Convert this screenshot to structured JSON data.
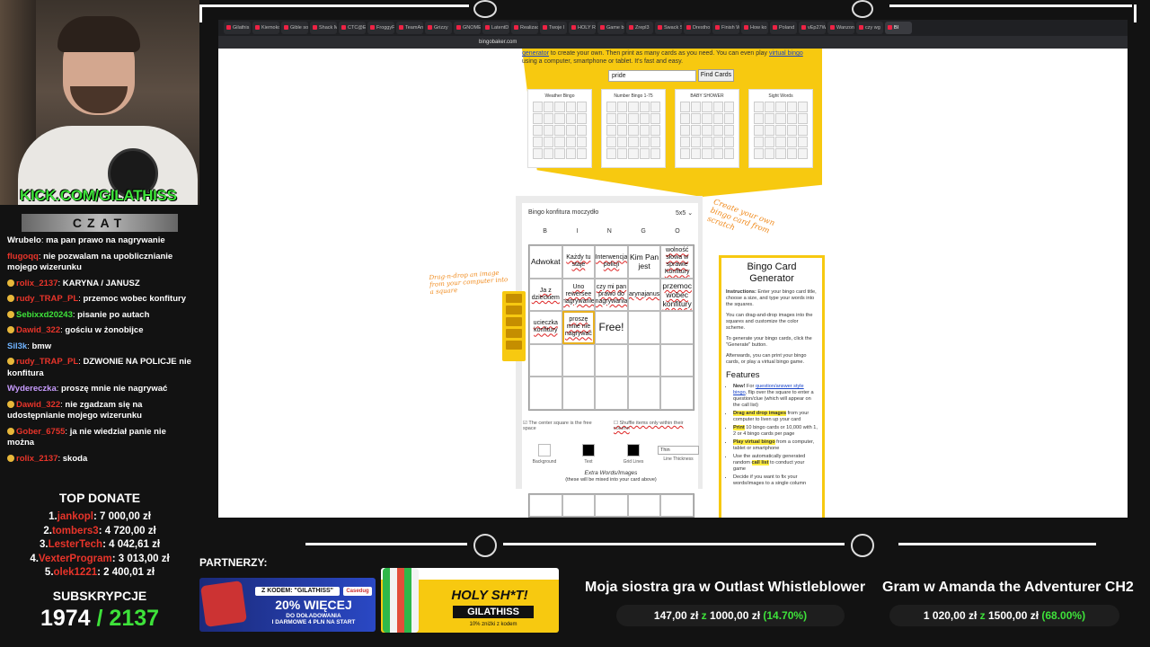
{
  "overlay": {
    "kick_handle": "KICK.COM/GILATHISS",
    "chat_title": "CZAT",
    "top_donate_title": "TOP DONATE",
    "subs_title": "SUBSKRYPCJE",
    "subs_current": "1974",
    "subs_goal": "/ 2137",
    "partners_label": "PARTNERZY:"
  },
  "chat": [
    {
      "user": "Wrubelo",
      "text": "ma pan prawo na nagrywanie",
      "user_color": "#ffffff",
      "badge": false
    },
    {
      "user": "flugoqq",
      "text": "nie pozwalam na upoblicznianie mojego wizerunku",
      "user_color": "#e8342a",
      "badge": false
    },
    {
      "user": "rolix_2137",
      "text": "KARYNA / JANUSZ",
      "user_color": "#e8342a",
      "badge": true
    },
    {
      "user": "rudy_TRAP_PL",
      "text": "przemoc wobec konfitury",
      "user_color": "#e8342a",
      "badge": true
    },
    {
      "user": "Sebixxd20243",
      "text": "pisanie po autach",
      "user_color": "#3ee23a",
      "badge": true
    },
    {
      "user": "Dawid_322",
      "text": "gościu w żonobijce",
      "user_color": "#e8342a",
      "badge": true
    },
    {
      "user": "Sil3k",
      "text": "bmw",
      "user_color": "#6fb3ff",
      "badge": false
    },
    {
      "user": "rudy_TRAP_PL",
      "text": "DZWONIE NA POLICJE nie konfitura",
      "user_color": "#e8342a",
      "badge": true
    },
    {
      "user": "Wydereczka",
      "text": "proszę mnie nie nagrywać",
      "user_color": "#c89cff",
      "badge": false
    },
    {
      "user": "Dawid_322",
      "text": "nie zgadzam się na udostępnianie mojego wizerunku",
      "user_color": "#e8342a",
      "badge": true
    },
    {
      "user": "Gober_6755",
      "text": "ja nie wiedział panie nie można",
      "user_color": "#e8342a",
      "badge": true
    },
    {
      "user": "rolix_2137",
      "text": "skoda",
      "user_color": "#e8342a",
      "badge": true
    }
  ],
  "donations": [
    {
      "rank": "1.",
      "name": "jankopl",
      "amount": "7 000,00 zł"
    },
    {
      "rank": "2.",
      "name": "tombers3",
      "amount": "4 720,00 zł"
    },
    {
      "rank": "3.",
      "name": "LesterTech",
      "amount": "4 042,61 zł"
    },
    {
      "rank": "4.",
      "name": "VexterProgram",
      "amount": "3 013,00 zł"
    },
    {
      "rank": "5.",
      "name": "olek1221",
      "amount": "2 400,01 zł"
    }
  ],
  "browser": {
    "url": "bingobaker.com",
    "tabs": [
      "Gilathis",
      "Kiemoko",
      "Gible so",
      "Shack M",
      "CTC@E",
      "FroggyF",
      "TeamAnn",
      "Grizzy",
      "GNOME",
      "LatentD",
      "Realizac",
      "Twoje l",
      "HOLY R",
      "Game b",
      "Zrepl3",
      "Swack S",
      "Drestho",
      "Finish W",
      "How ko",
      "Poland",
      "vEp27W",
      "Wanzon",
      "czy wg",
      "BI"
    ]
  },
  "page": {
    "intro_link1": "generator",
    "intro_text1": " to create your own. Then print as many cards as you need. You can even play ",
    "intro_link2": "virtual bingo",
    "intro_text2": " using a computer, smartphone or tablet. It's fast and easy.",
    "search_value": "pride",
    "find_button": "Find Cards",
    "sample_cards": [
      "Weather Bingo",
      "Number Bingo 1-75",
      "BABY SHOWER",
      "Sight Words"
    ],
    "annotation_create": "Create your own bingo card from scratch",
    "annotation_drag": "Drag-n-drop an image from your computer into a square"
  },
  "editor": {
    "title": "Bingo konfitura moczydło",
    "size": "5x5 ⌄",
    "letters": [
      "B",
      "I",
      "N",
      "G",
      "O"
    ],
    "cells": [
      "Adwokat",
      "Każdy tu staje",
      "Interwencja policji",
      "Kim Pan jest",
      "wolność słowa w sprawie Konfitury",
      "Ja z dzieckiem",
      "Uno rewersee nagrywanie",
      "czy mi pan prawo do nagrywania",
      "karynajanusz",
      "przemoc wobec konfitury",
      "ucieczka konfitury",
      "proszę mnie nie nagrywać",
      "Free!",
      "",
      "",
      "",
      "",
      "",
      "",
      "",
      "",
      "",
      "",
      "",
      ""
    ],
    "opt_free": "The center square is the free space",
    "opt_shuffle": "Shuffle items only within their column",
    "swatches": [
      {
        "label": "Background",
        "color": "#ffffff"
      },
      {
        "label": "Text",
        "color": "#000000"
      },
      {
        "label": "Grid Lines",
        "color": "#000000"
      }
    ],
    "thickness_value": "Thin",
    "thickness_label": "Line Thickness",
    "extra_title": "Extra Words/Images",
    "extra_sub": "(these will be mixed into your card above)"
  },
  "sidebar": {
    "title": "Bingo Card Generator",
    "instructions_label": "Instructions:",
    "instructions": " Enter your bingo card title, choose a size, and type your words into the squares.",
    "p2": "You can drag-and-drop images into the squares and customize the color scheme.",
    "p3": "To generate your bingo cards, click the \"Generate\" button.",
    "p4": "Afterwards, you can print your bingo cards, or play a virtual bingo game.",
    "features_title": "Features",
    "f1_new": "New!",
    "f1_text": " For ",
    "f1_link": "question/answer style bingo",
    "f1_rest": ", flip over the square to enter a question/clue (which will appear on the call list)",
    "f2_hl": "Drag and drop images",
    "f2_rest": " from your computer to liven up your card",
    "f3_hl": "Print",
    "f3_rest": " 10 bingo cards or 10,000 with 1, 2 or 4 bingo cards per page",
    "f4_hl": "Play virtual bingo",
    "f4_rest": " from a computer, tablet or smartphone",
    "f5_a": "Use the automatically generated random ",
    "f5_hl": "call list",
    "f5_b": " to conduct your game",
    "f6": "Decide if you want to fix your words/images to a single column"
  },
  "ads": {
    "ad1_code": "Z KODEM: \"GILATHISS\"",
    "ad1_brand": "Casedug",
    "ad1_pct": "20% WIĘCEJ",
    "ad1_sub1": "DO DOŁADOWANIA",
    "ad1_sub2": "I DARMOWE 4 PLN NA START",
    "ad2_title": "HOLY SH*T!",
    "ad2_code": "GILATHISS",
    "ad2_sub": "10% zniżki z kodem"
  },
  "goals": [
    {
      "title": "Moja siostra gra w Outlast Whistleblower",
      "current": "147,00 zł",
      "z": "z",
      "target": "1000,00 zł",
      "percent": "(14.70%)"
    },
    {
      "title": "Gram w Amanda the Adventurer CH2",
      "current": "1 020,00 zł",
      "z": "z",
      "target": "1500,00 zł",
      "percent": "(68.00%)"
    }
  ]
}
